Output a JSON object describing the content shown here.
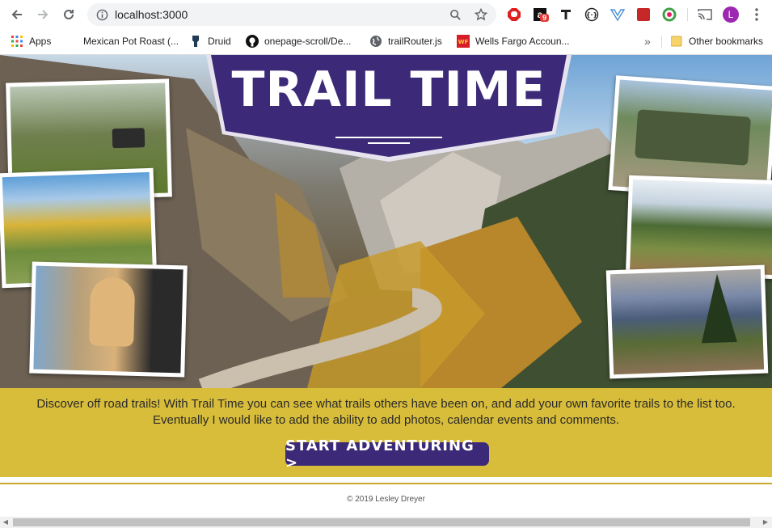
{
  "browser": {
    "url": "localhost:3000",
    "profile_initial": "L",
    "extension_badge": "9"
  },
  "bookmarks": {
    "items": [
      {
        "label": "Apps",
        "icon": "apps-grid-icon"
      },
      {
        "label": "Mexican Pot Roast (...",
        "icon": "page-icon"
      },
      {
        "label": "Druid",
        "icon": "druid-icon"
      },
      {
        "label": "onepage-scroll/De...",
        "icon": "github-icon"
      },
      {
        "label": "trailRouter.js",
        "icon": "globe-icon"
      },
      {
        "label": "Wells Fargo Accoun...",
        "icon": "wells-fargo-icon"
      }
    ],
    "overflow": "»",
    "other": "Other bookmarks"
  },
  "hero": {
    "title": "TRAIL TIME"
  },
  "intro": {
    "text": "Discover off road trails! With Trail Time you can see what trails others have been on, and add your own favorite trails to the list too. Eventually I would like to add the ability to add photos, calendar events and comments."
  },
  "cta": {
    "label": "START ADVENTURING >"
  },
  "footer": {
    "copyright": "© 2019 Lesley Dreyer"
  },
  "colors": {
    "brand_purple": "#3c2a78",
    "band_yellow": "#d8bd3a",
    "gold_rule": "#c9a92b"
  }
}
